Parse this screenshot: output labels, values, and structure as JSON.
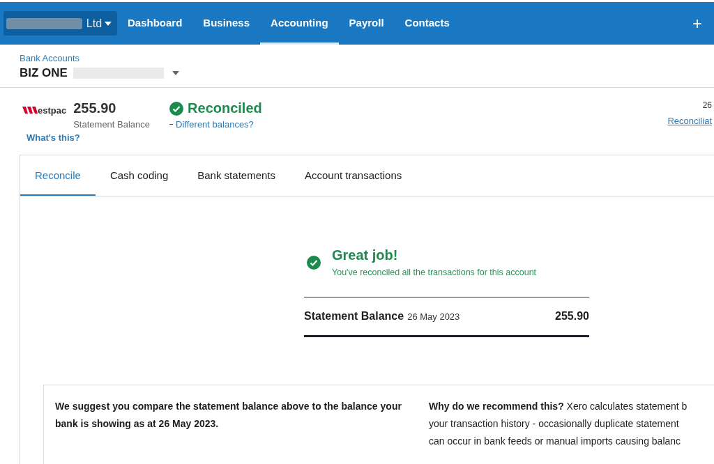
{
  "nav": {
    "org_suffix": "Ltd",
    "items": [
      {
        "label": "Dashboard",
        "selected": false
      },
      {
        "label": "Business",
        "selected": false
      },
      {
        "label": "Accounting",
        "selected": true
      },
      {
        "label": "Payroll",
        "selected": false
      },
      {
        "label": "Contacts",
        "selected": false
      }
    ],
    "add": "+"
  },
  "header": {
    "breadcrumb": "Bank Accounts",
    "account": "BIZ ONE"
  },
  "summary": {
    "bank": "estpac",
    "balance": "255.90",
    "balance_label": "Statement Balance",
    "whats_this": "What's this?",
    "status": "Reconciled",
    "different": "Different balances?",
    "right_date": "26",
    "right_link": "Reconciliat"
  },
  "tabs": [
    {
      "label": "Reconcile",
      "selected": true
    },
    {
      "label": "Cash coding",
      "selected": false
    },
    {
      "label": "Bank statements",
      "selected": false
    },
    {
      "label": "Account transactions",
      "selected": false
    }
  ],
  "success": {
    "title": "Great job!",
    "message": "You've reconciled all the transactions for this account"
  },
  "statement": {
    "label": "Statement Balance",
    "date": "26 May 2023",
    "amount": "255.90"
  },
  "notice": {
    "left": "We suggest you compare the statement balance above to the balance your bank is showing as at 26 May 2023.",
    "right_lines": [
      "**Why do we recommend this?** Xero calculates statement b",
      "your transaction history - occasionally duplicate statement",
      "can occur in bank feeds or manual imports causing balanc"
    ]
  }
}
